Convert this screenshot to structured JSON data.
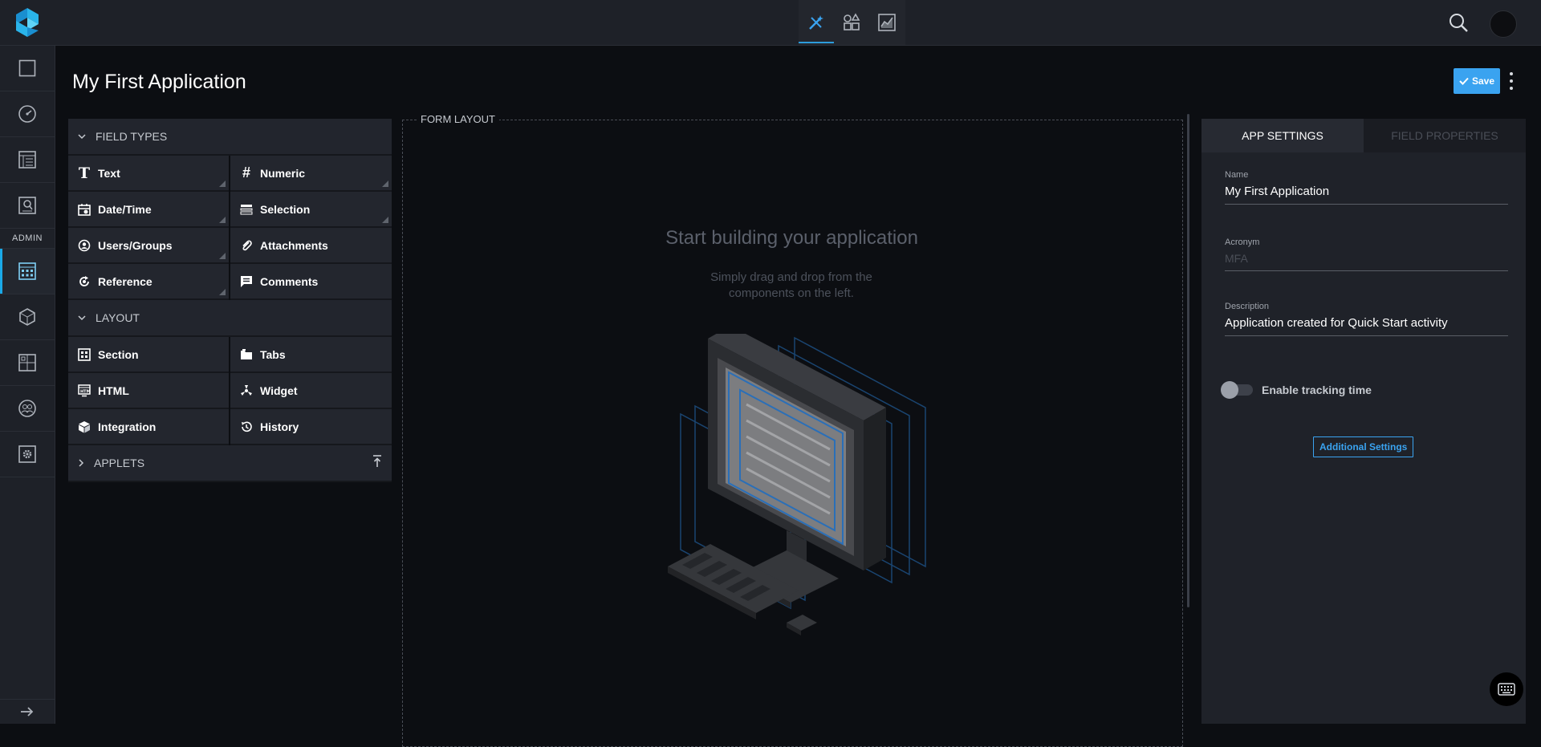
{
  "header": {
    "mode_tabs": [
      {
        "name": "design",
        "icon": "wand-ruler-icon"
      },
      {
        "name": "workflow",
        "icon": "shapes-icon"
      },
      {
        "name": "reports",
        "icon": "chart-icon"
      }
    ]
  },
  "sidebar": {
    "admin_label": "ADMIN"
  },
  "page": {
    "title": "My First Application",
    "save_label": "Save"
  },
  "palette": {
    "field_types_label": "FIELD TYPES",
    "field_types": [
      {
        "label": "Text",
        "icon": "text-icon",
        "has_more": true
      },
      {
        "label": "Numeric",
        "icon": "hash-icon",
        "has_more": true
      },
      {
        "label": "Date/Time",
        "icon": "calendar-icon",
        "has_more": true
      },
      {
        "label": "Selection",
        "icon": "list-icon",
        "has_more": true
      },
      {
        "label": "Users/Groups",
        "icon": "user-icon",
        "has_more": true
      },
      {
        "label": "Attachments",
        "icon": "paperclip-icon",
        "has_more": false
      },
      {
        "label": "Reference",
        "icon": "reference-icon",
        "has_more": true
      },
      {
        "label": "Comments",
        "icon": "comment-icon",
        "has_more": false
      }
    ],
    "layout_label": "LAYOUT",
    "layout_items": [
      {
        "label": "Section",
        "icon": "section-icon"
      },
      {
        "label": "Tabs",
        "icon": "tabs-icon"
      },
      {
        "label": "HTML",
        "icon": "html-icon"
      },
      {
        "label": "Widget",
        "icon": "widget-icon"
      },
      {
        "label": "Integration",
        "icon": "cube-icon"
      },
      {
        "label": "History",
        "icon": "history-icon"
      }
    ],
    "applets_label": "APPLETS"
  },
  "canvas": {
    "label": "FORM LAYOUT",
    "empty_title": "Start building your application",
    "empty_subtitle": "Simply drag and drop from the components on the left."
  },
  "settings": {
    "tabs": [
      "APP SETTINGS",
      "FIELD PROPERTIES"
    ],
    "name_label": "Name",
    "name_value": "My First Application",
    "acronym_label": "Acronym",
    "acronym_placeholder": "MFA",
    "description_label": "Description",
    "description_value": "Application created for Quick Start activity",
    "tracking_label": "Enable tracking time",
    "tracking_enabled": false,
    "additional_settings_label": "Additional Settings"
  },
  "colors": {
    "accent": "#3aa3f0",
    "rail_active": "#1aa9e8",
    "background": "#0c0e12",
    "panel": "#1f2229"
  }
}
